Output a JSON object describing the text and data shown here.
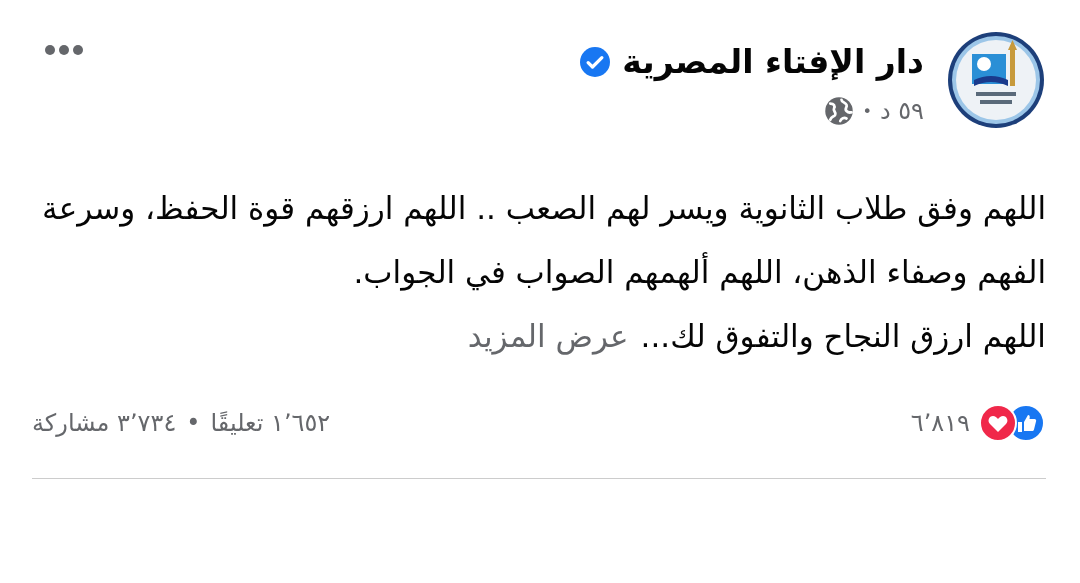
{
  "post": {
    "author": {
      "name": "دار الإفتاء المصرية",
      "verified": true
    },
    "time": "٥٩ د",
    "separator": "•",
    "text": {
      "paragraphs": [
        "اللهم وفق طلاب الثانوية ويسر لهم الصعب .. اللهم ارزقهم قوة الحفظ، وسرعة الفهم وصفاء الذهن، اللهم ألهمهم الصواب في الجواب.",
        "اللهم ارزق النجاح والتفوق لك..."
      ],
      "see_more": "عرض المزيد"
    },
    "reactions": {
      "count": "٦٬٨١٩"
    },
    "comments": "١٬٦٥٢ تعليقًا",
    "stats_separator": "•",
    "shares": "٣٬٧٣٤ مشاركة"
  }
}
